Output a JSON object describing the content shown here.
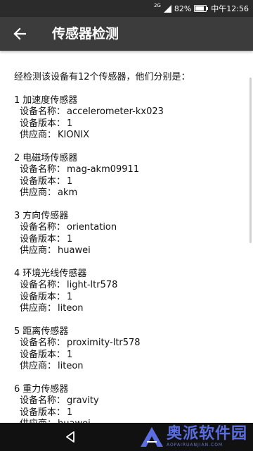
{
  "status_bar": {
    "network_type": "2G",
    "battery": "82%",
    "time": "中午12:56",
    "icons": [
      "signal-icon",
      "battery-icon"
    ]
  },
  "app_bar": {
    "title": "传感器检测",
    "back_icon": "arrow-left-icon"
  },
  "intro": "经检测该设备有12个传感器，他们分别是：",
  "field_labels": {
    "name": "设备名称：",
    "version": "设备版本：",
    "vendor": "供应商："
  },
  "sensors": [
    {
      "num": "1",
      "type": "加速度传感器",
      "name": "accelerometer-kx023",
      "version": "1",
      "vendor": "KIONIX"
    },
    {
      "num": "2",
      "type": "电磁场传感器",
      "name": "mag-akm09911",
      "version": "1",
      "vendor": "akm"
    },
    {
      "num": "3",
      "type": "方向传感器",
      "name": "orientation",
      "version": "1",
      "vendor": "huawei"
    },
    {
      "num": "4",
      "type": "环境光线传感器",
      "name": "light-ltr578",
      "version": "1",
      "vendor": "liteon"
    },
    {
      "num": "5",
      "type": "距离传感器",
      "name": "proximity-ltr578",
      "version": "1",
      "vendor": "liteon"
    },
    {
      "num": "6",
      "type": "重力传感器",
      "name": "gravity",
      "version": "1",
      "vendor": "huawei"
    }
  ],
  "nav_bar": {
    "back_icon": "triangle-back-icon"
  },
  "watermark": {
    "name": "奥派软件园",
    "url": "AOPAIRUANJIAN.COM"
  },
  "colors": {
    "status_bar": "#2b2b2b",
    "app_bar": "#3c3c3c",
    "nav_bar": "#111111",
    "watermark": "#5b6ee1"
  }
}
